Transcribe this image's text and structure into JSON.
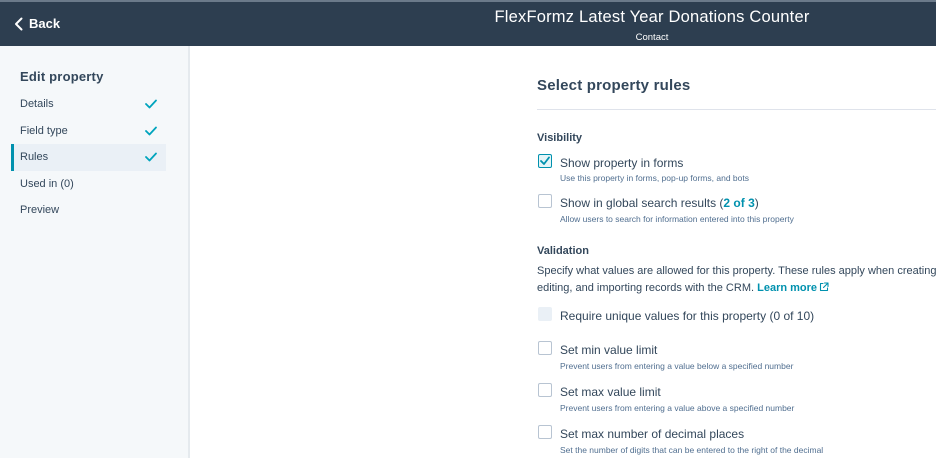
{
  "header": {
    "back_label": "Back",
    "title": "FlexFormz Latest Year Donations Counter",
    "subtitle": "Contact"
  },
  "sidebar": {
    "heading": "Edit property",
    "items": [
      {
        "label": "Details",
        "complete": true
      },
      {
        "label": "Field type",
        "complete": true
      },
      {
        "label": "Rules",
        "complete": true,
        "active": true
      },
      {
        "label": "Used in (0)",
        "complete": false
      },
      {
        "label": "Preview",
        "complete": false
      }
    ]
  },
  "main": {
    "heading": "Select property rules",
    "visibility": {
      "label": "Visibility",
      "show_in_forms": {
        "label": "Show property in forms",
        "help": "Use this property in forms, pop-up forms, and bots",
        "checked": true
      },
      "global_search": {
        "label_prefix": "Show in global search results (",
        "count": "2 of 3",
        "label_suffix": ")",
        "help": "Allow users to search for information entered into this property",
        "checked": false
      }
    },
    "validation": {
      "label": "Validation",
      "desc_line1": "Specify what values are allowed for this property. These rules apply when creating,",
      "desc_line2": "editing, and importing records with the CRM.",
      "learn_more": "Learn more",
      "unique": {
        "label": "Require unique values for this property (0 of 10)",
        "disabled": true
      },
      "min": {
        "label": "Set min value limit",
        "help": "Prevent users from entering a value below a specified number"
      },
      "max": {
        "label": "Set max value limit",
        "help": "Prevent users from entering a value above a specified number"
      },
      "decimals": {
        "label": "Set max number of decimal places",
        "help": "Set the number of digits that can be entered to the right of the decimal"
      }
    }
  },
  "colors": {
    "header_bg": "#2d3e50",
    "accent": "#0091ae",
    "sidebar_bg": "#f5f8fa",
    "text": "#33475b"
  }
}
